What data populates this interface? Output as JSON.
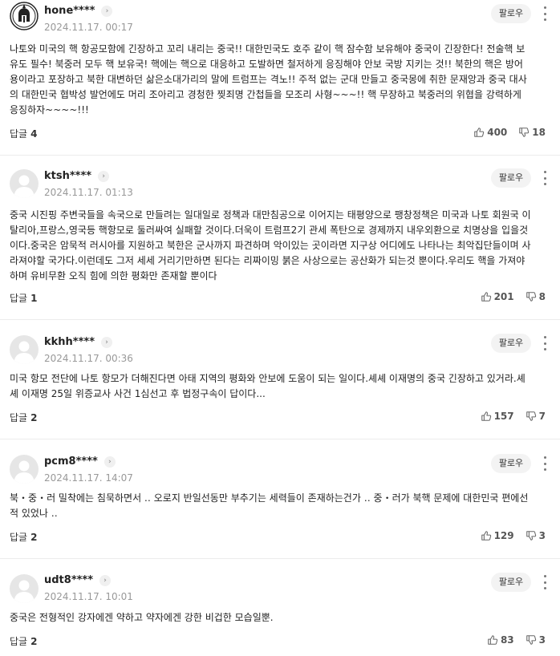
{
  "ui": {
    "follow_label": "팔로우",
    "reply_label": "답글"
  },
  "comments": [
    {
      "nickname": "hone****",
      "date": "2024.11.17. 00:17",
      "text": "나토와 미국의 핵 항공모함에 긴장하고 꼬리 내리는 중국!! 대한민국도 호주 같이 핵 잠수함 보유해야 중국이 긴장한다! 전술핵 보유도 필수! 북중러 모두 핵 보유국! 핵에는 핵으로 대응하고 도발하면 철저하게 응징해야 안보 국방 지키는 것!! 북한의 핵은 방어용이라고 포장하고 북한 대변하던 삶은소대가리의 말에 트럼프는 격노!! 주적 없는 군대 만들고 중국몽에 취한 문재앙과 중국 대사의 대한민국 협박성 발언에도 머리 조아리고 경청한 찢죄명 간첩들을 모조리 사형~~~!! 핵 무장하고 북중러의 위협을 강력하게 응징하자~~~~!!!",
      "replies": "4",
      "likes": "400",
      "dislikes": "18",
      "avatar": "warrior-helmet-avatar"
    },
    {
      "nickname": "ktsh****",
      "date": "2024.11.17. 01:13",
      "text": "중국 시진핑 주변국들을 속국으로 만들려는 일대일로 정책과 대만침공으로 이어지는 태평양으로 팽창정책은 미국과 나토 회원국 이탈리아,프랑스,영국등 핵항모로 둘러싸여 실패할 것이다.더욱이 트럼프2기 관세 폭탄으로 경제까지 내우외환으로 치명상을 입을것이다.중국은 암묵적 러시아를 지원하고 북한은 군사까지 파견하며 악이있는 곳이라면 지구상 어디에도 나타나는 최악집단들이며 사라져야할 국가다.이런데도 그저 세세 거리기만하면 된다는 리짜이밍 붉은 사상으로는 공산화가 되는것 뿐이다.우리도 핵을 가져야하며 유비무환 오직 힘에 의한 평화만 존재할 뿐이다",
      "replies": "1",
      "likes": "201",
      "dislikes": "8",
      "avatar": "default-user-avatar"
    },
    {
      "nickname": "kkhh****",
      "date": "2024.11.17. 00:36",
      "text": "미국 항모 전단에 나토 항모가 더해진다면 아태 지역의 평화와 안보에 도움이 되는 일이다.셰셰 이재명의 중국 긴장하고 있거라.셰셰 이재명 25일 위증교사 사건 1심선고 후 법정구속이 답이다...",
      "replies": "2",
      "likes": "157",
      "dislikes": "7",
      "avatar": "default-user-avatar"
    },
    {
      "nickname": "pcm8****",
      "date": "2024.11.17. 14:07",
      "text": "북・중・러 밀착에는 침묵하면서 ‥ 오로지 반일선동만 부추기는 세력들이 존재하는건가 ‥ 중・러가 북핵 문제에 대한민국 편에선적 있었나 ‥",
      "replies": "2",
      "likes": "129",
      "dislikes": "3",
      "avatar": "default-user-avatar"
    },
    {
      "nickname": "udt8****",
      "date": "2024.11.17. 10:01",
      "text": "중국은 전형적인 강자에겐 약하고 약자에겐 강한 비겁한 모습일뿐.",
      "replies": "2",
      "likes": "83",
      "dislikes": "3",
      "avatar": "default-user-avatar"
    }
  ]
}
